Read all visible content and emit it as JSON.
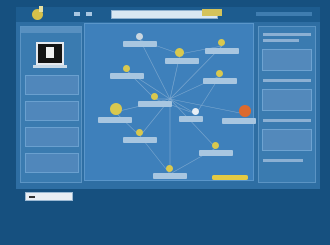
{
  "window": {
    "title": ""
  },
  "colors": {
    "background": "#16507f",
    "panel": "#2e6ea3",
    "accent": "#e4ca43",
    "highlight": "#dc6a2e"
  },
  "nodes": [
    {
      "label": "",
      "icon": "planet-icon"
    },
    {
      "label": "",
      "icon": "planet-icon"
    },
    {
      "label": "",
      "icon": "planet-icon"
    },
    {
      "label": "",
      "icon": "planet-icon"
    },
    {
      "label": "",
      "icon": "planet-icon"
    },
    {
      "label": "",
      "icon": "planet-icon"
    },
    {
      "label": "",
      "icon": "planet-icon"
    },
    {
      "label": "",
      "icon": "planet-icon"
    },
    {
      "label": "",
      "icon": "planet-icon"
    },
    {
      "label": "",
      "icon": "planet-icon"
    },
    {
      "label": "",
      "icon": "planet-icon"
    },
    {
      "label": "",
      "icon": "planet-icon"
    }
  ]
}
